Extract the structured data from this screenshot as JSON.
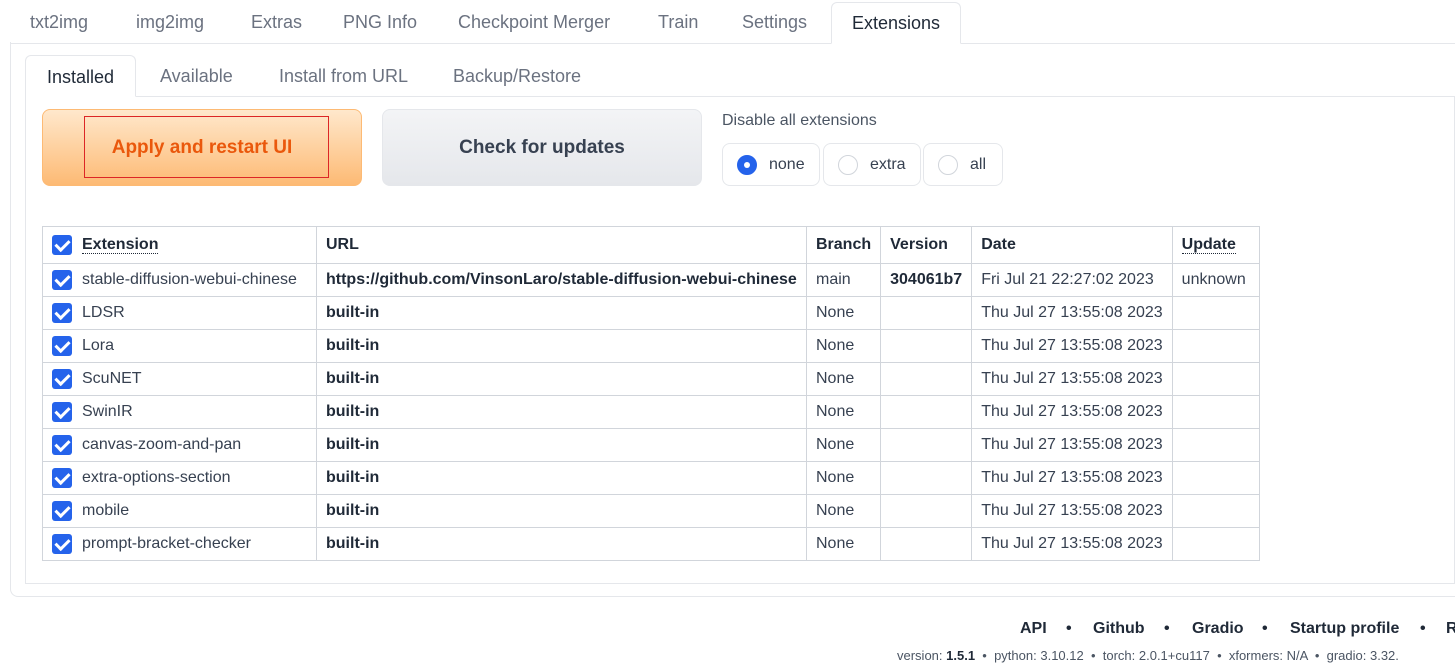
{
  "top_tabs": [
    "txt2img",
    "img2img",
    "Extras",
    "PNG Info",
    "Checkpoint Merger",
    "Train",
    "Settings",
    "Extensions"
  ],
  "sub_tabs": [
    "Installed",
    "Available",
    "Install from URL",
    "Backup/Restore"
  ],
  "buttons": {
    "apply": "Apply and restart UI",
    "check": "Check for updates"
  },
  "disable": {
    "label": "Disable all extensions",
    "options": [
      "none",
      "extra",
      "all"
    ],
    "selected": "none"
  },
  "table": {
    "headers": [
      "Extension",
      "URL",
      "Branch",
      "Version",
      "Date",
      "Update"
    ],
    "rows": [
      {
        "name": "stable-diffusion-webui-chinese",
        "url": "https://github.com/VinsonLaro/stable-diffusion-webui-chinese",
        "branch": "main",
        "version": "304061b7",
        "date": "Fri Jul 21 22:27:02 2023",
        "update": "unknown"
      },
      {
        "name": "LDSR",
        "url": "built-in",
        "branch": "None",
        "version": "",
        "date": "Thu Jul 27 13:55:08 2023",
        "update": ""
      },
      {
        "name": "Lora",
        "url": "built-in",
        "branch": "None",
        "version": "",
        "date": "Thu Jul 27 13:55:08 2023",
        "update": ""
      },
      {
        "name": "ScuNET",
        "url": "built-in",
        "branch": "None",
        "version": "",
        "date": "Thu Jul 27 13:55:08 2023",
        "update": ""
      },
      {
        "name": "SwinIR",
        "url": "built-in",
        "branch": "None",
        "version": "",
        "date": "Thu Jul 27 13:55:08 2023",
        "update": ""
      },
      {
        "name": "canvas-zoom-and-pan",
        "url": "built-in",
        "branch": "None",
        "version": "",
        "date": "Thu Jul 27 13:55:08 2023",
        "update": ""
      },
      {
        "name": "extra-options-section",
        "url": "built-in",
        "branch": "None",
        "version": "",
        "date": "Thu Jul 27 13:55:08 2023",
        "update": ""
      },
      {
        "name": "mobile",
        "url": "built-in",
        "branch": "None",
        "version": "",
        "date": "Thu Jul 27 13:55:08 2023",
        "update": ""
      },
      {
        "name": "prompt-bracket-checker",
        "url": "built-in",
        "branch": "None",
        "version": "",
        "date": "Thu Jul 27 13:55:08 2023",
        "update": ""
      }
    ]
  },
  "footer": {
    "links": [
      "API",
      "Github",
      "Gradio",
      "Startup profile",
      "R"
    ],
    "versions": [
      {
        "label": "version:",
        "value": "1.5.1"
      },
      {
        "label": "python:",
        "value": "3.10.12"
      },
      {
        "label": "torch:",
        "value": "2.0.1+cu117"
      },
      {
        "label": "xformers:",
        "value": "N/A"
      },
      {
        "label": "gradio:",
        "value": "3.32."
      }
    ]
  },
  "colors": {
    "accent": "#2563eb",
    "apply_text": "#ea580c",
    "apply_bg": "#fdba74"
  }
}
